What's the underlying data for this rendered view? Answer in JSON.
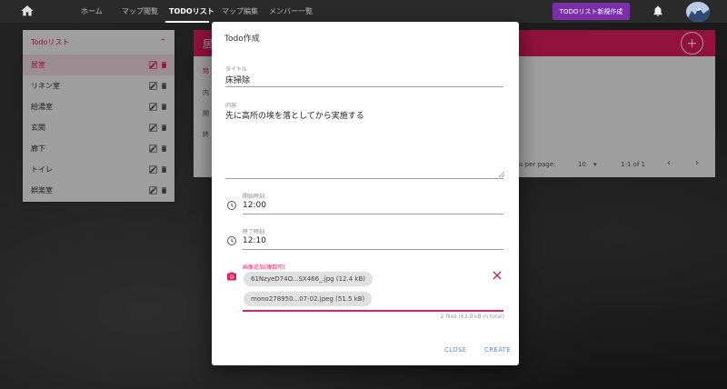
{
  "nav": {
    "items": [
      "ホーム",
      "マップ閲覧",
      "TODOリスト",
      "マップ編集",
      "メンバー一覧"
    ],
    "new_button": "TODOリスト新規作成"
  },
  "todo_list": {
    "title": "Todoリスト",
    "items": [
      "居室",
      "リネン室",
      "給湯室",
      "玄関",
      "廊下",
      "トイレ",
      "娯楽室"
    ],
    "selected_index": 0
  },
  "main": {
    "header_text": "居",
    "side_labels": [
      "宛",
      "内",
      "開",
      "終"
    ],
    "rows_per_page_label": "Items per page:",
    "rows_per_page_value": "10",
    "range": "1-1 of 1"
  },
  "dialog": {
    "title": "Todo作成",
    "title_field": {
      "label": "タイトル",
      "value": "床掃除"
    },
    "content_field": {
      "label": "内容",
      "value": "先に高所の埃を落としてから実施する"
    },
    "start_field": {
      "label": "開始時刻",
      "value": "12:00"
    },
    "end_field": {
      "label": "終了時刻",
      "value": "12:10"
    },
    "image_field": {
      "label": "画像追加(複数可)",
      "files": [
        "61NzyeD74O...SX466_.jpg (12.4 kB)",
        "mono278950...07-02.jpeg (51.5 kB)"
      ],
      "total": "2 files (63.9 kB in total)"
    },
    "close_button": "CLOSE",
    "create_button": "CREATE"
  },
  "colors": {
    "accent": "#e91e63",
    "purple": "#7b2fa8",
    "link": "#5b8fd6"
  }
}
